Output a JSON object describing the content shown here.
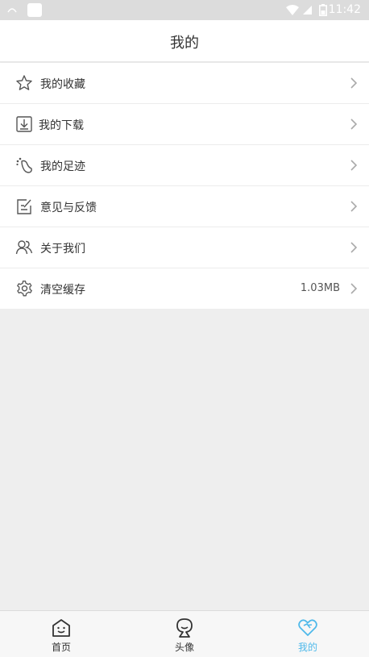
{
  "status_bar": {
    "time": "11:42"
  },
  "header": {
    "title": "我的"
  },
  "menu": {
    "items": [
      {
        "icon": "star-icon",
        "label": "我的收藏",
        "value": ""
      },
      {
        "icon": "download-icon",
        "label": "我的下载",
        "value": ""
      },
      {
        "icon": "footprint-icon",
        "label": "我的足迹",
        "value": ""
      },
      {
        "icon": "feedback-icon",
        "label": "意见与反馈",
        "value": ""
      },
      {
        "icon": "people-icon",
        "label": "关于我们",
        "value": ""
      },
      {
        "icon": "gear-icon",
        "label": "清空缓存",
        "value": "1.03MB"
      }
    ]
  },
  "tabbar": {
    "tabs": [
      {
        "icon": "home-face-icon",
        "label": "首页",
        "active": false
      },
      {
        "icon": "avatar-icon",
        "label": "头像",
        "active": false
      },
      {
        "icon": "heart-icon",
        "label": "我的",
        "active": true
      }
    ]
  },
  "colors": {
    "accent": "#4fb9ea",
    "text": "#333333",
    "background": "#eeeeee",
    "status_bar": "#dcdcdc"
  }
}
